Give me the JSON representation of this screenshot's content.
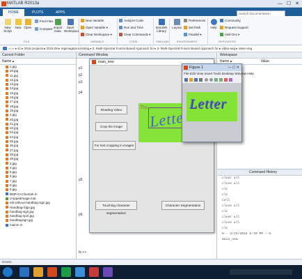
{
  "titlebar": {
    "title": "MATLAB R2013a",
    "controls": "— ☐ ✕"
  },
  "tabs": [
    {
      "label": "HOME"
    },
    {
      "label": "PLOTS"
    },
    {
      "label": "APPS"
    }
  ],
  "ribbon": {
    "new_script": "New\nScript",
    "new": "New",
    "open": "Open",
    "find_files": "Find Files",
    "compare": "Compare",
    "import_data": "Import\nData",
    "save_workspace": "Save\nWorkspace",
    "new_variable": "New Variable",
    "open_variable": "Open Variable ▾",
    "clear_workspace": "Clear Workspace ▾",
    "analyze_code": "Analyze Code",
    "run_and_time": "Run and Time",
    "clear_commands": "Clear Commands ▾",
    "simulink_library": "Simulink\nLibrary",
    "layout": "Layout",
    "preferences": "Preferences",
    "set_path": "Set Path",
    "parallel": "Parallel ▾",
    "help": "Help",
    "community": "Community",
    "request_support": "Request Support",
    "add_ons": "Add-Ons ▾",
    "groups": [
      "FILE",
      "VARIABLE",
      "CODE",
      "SIMULINK",
      "ENVIRONMENT",
      "RESOURCES"
    ],
    "search_placeholder": "Search Documentation"
  },
  "path": "⇦ ⇨ ▸ D: ▸ 2016 projects ▸ 2015.09 ▸ regimageprocessing ▸ 3. Multi-Spectral Fusion Based Approach for ▸ 3. Multi-Spectral Fusion Based Approach for ▸ video-seg ▸ video-seg",
  "current_folder": {
    "title": "Current Folder",
    "column": "Name ▴",
    "files": [
      "1.jpg",
      "10.jpg",
      "11.jpg",
      "12.jpg",
      "13.jpg",
      "14.jpg",
      "15.jpg",
      "16.jpg",
      "17.jpg",
      "18.jpg",
      "19.jpg",
      "2.jpg",
      "20.jpg",
      "21.jpg",
      "22.jpg",
      "23.jpg",
      "24.jpg",
      "25.jpg",
      "26.jpg",
      "27.jpg",
      "28.jpg",
      "29.jpg",
      "3.jpg",
      "4.jpg",
      "5.jpg",
      "6.jpg",
      "7.jpg",
      "8.jpg",
      "9.jpg",
      "BMP-CACheetah.m",
      "croppedImage.mat",
      "edi-without-handbag-sign.jpg",
      "Handbag-Sign.jpg",
      "handbag-sign.jpg",
      "handbag-spot.jpg",
      "handbagsign.jpg",
      "mainm.m"
    ],
    "details": "Details"
  },
  "command_window": {
    "title": "Command Window",
    "prompt": "fx >>",
    "margin_labels": [
      "p1",
      "p2",
      "p3",
      "p4",
      "p5",
      "p6"
    ]
  },
  "gui": {
    "title": "main_new",
    "buttons": {
      "reading_video": "Reading Video",
      "crop_image": "Crop the image",
      "for_text_cropping": "For text cropping in images",
      "touching_char_seg": "Touching character segmentation",
      "char_seg": "Character Segmentation"
    },
    "image_text": "Letter",
    "image_small_text": "The"
  },
  "figure1": {
    "title": "Figure 1",
    "menu": "File  Edit  View  Insert  Tools  Desktop  Window  Help",
    "image_text": "Letter",
    "controls": "— ☐ ✕"
  },
  "workspace": {
    "title": "Workspace",
    "col_name": "Name ▴",
    "col_value": "Value"
  },
  "history": {
    "title": "Command History",
    "lines": [
      "clear all",
      "close all",
      "clc",
      "clc",
      "cell",
      "close all",
      "clc",
      "clear all",
      "close all",
      "clc",
      "%-- 3/25/2016 5:40 PM --%",
      "main_new"
    ]
  },
  "colors": {
    "accent": "#1d5d9a",
    "image_green": "#86e33a",
    "letter_blue": "#4a5fd0"
  }
}
